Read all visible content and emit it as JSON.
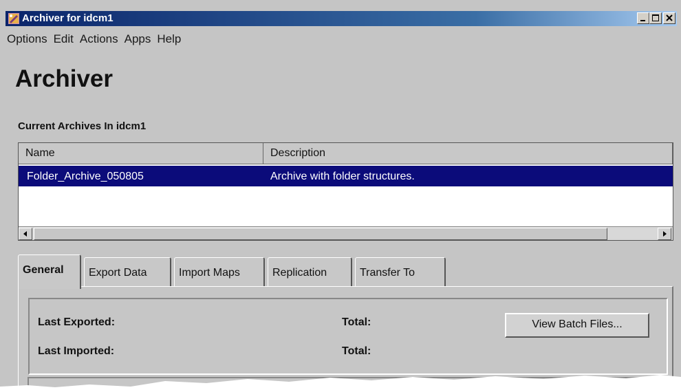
{
  "window": {
    "title": "Archiver for idcm1",
    "buttons": [
      "minimize",
      "maximize",
      "close"
    ]
  },
  "menu": [
    "Options",
    "Edit",
    "Actions",
    "Apps",
    "Help"
  ],
  "page": {
    "title": "Archiver",
    "section_label": "Current Archives In idcm1"
  },
  "table": {
    "columns": [
      "Name",
      "Description"
    ],
    "rows": [
      {
        "name": "Folder_Archive_050805",
        "description": "Archive with folder structures.",
        "selected": true
      }
    ]
  },
  "tabs": [
    {
      "label": "General",
      "active": true
    },
    {
      "label": "Export Data",
      "active": false
    },
    {
      "label": "Import Maps",
      "active": false
    },
    {
      "label": "Replication",
      "active": false
    },
    {
      "label": "Transfer To",
      "active": false
    }
  ],
  "general": {
    "last_exported_label": "Last Exported:",
    "last_imported_label": "Last Imported:",
    "total_label_1": "Total:",
    "total_label_2": "Total:",
    "view_batch_files_label": "View Batch Files..."
  },
  "colors": {
    "selection": "#0b0b7a",
    "titlebar_start": "#0a246a",
    "background": "#c5c5c5"
  }
}
